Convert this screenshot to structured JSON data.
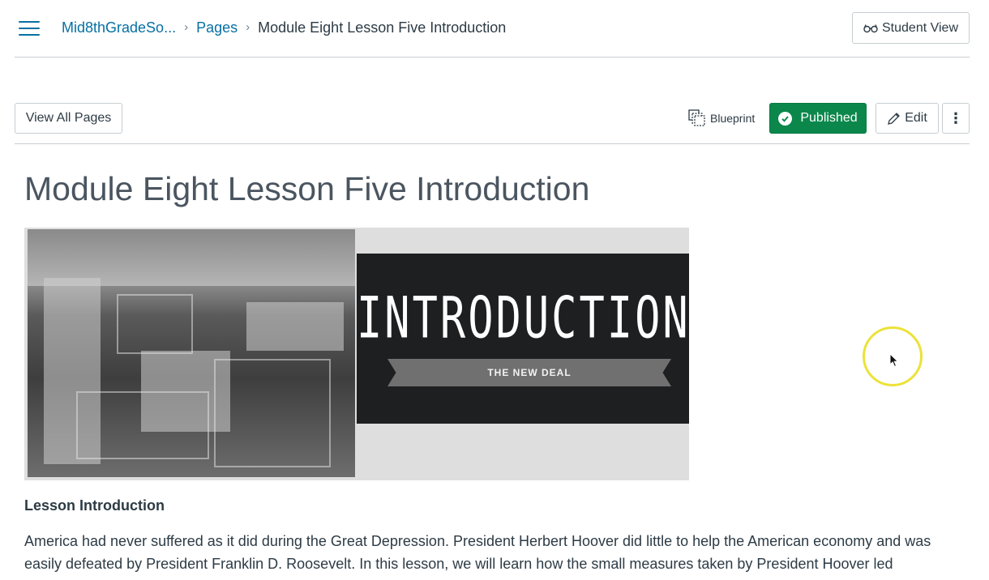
{
  "header": {
    "breadcrumbs": [
      "Mid8thGradeSo...",
      "Pages",
      "Module Eight Lesson Five Introduction"
    ],
    "student_view_label": "Student View"
  },
  "toolbar": {
    "view_all_pages_label": "View All Pages",
    "blueprint_label": "Blueprint",
    "published_label": "Published",
    "edit_label": "Edit",
    "more_label": "⋮"
  },
  "content": {
    "page_title": "Module Eight Lesson Five Introduction",
    "banner": {
      "title": "INTRODUCTION",
      "subtitle": "THE NEW DEAL"
    },
    "lesson_heading": "Lesson Introduction",
    "lesson_text": "America had never suffered as it did during the Great Depression. President Herbert Hoover did little to help the American economy and was easily defeated by President Franklin D. Roosevelt. In this lesson, we will learn how the small measures taken by President Hoover led"
  },
  "colors": {
    "link": "#0770a3",
    "published": "#0b874b",
    "cursor_highlight": "#ece23a"
  },
  "icons": {
    "menu": "hamburger-icon",
    "student_view": "glasses-icon",
    "blueprint": "blueprint-icon",
    "published": "check-circle-icon",
    "edit": "pencil-icon",
    "more": "kebab-icon"
  }
}
